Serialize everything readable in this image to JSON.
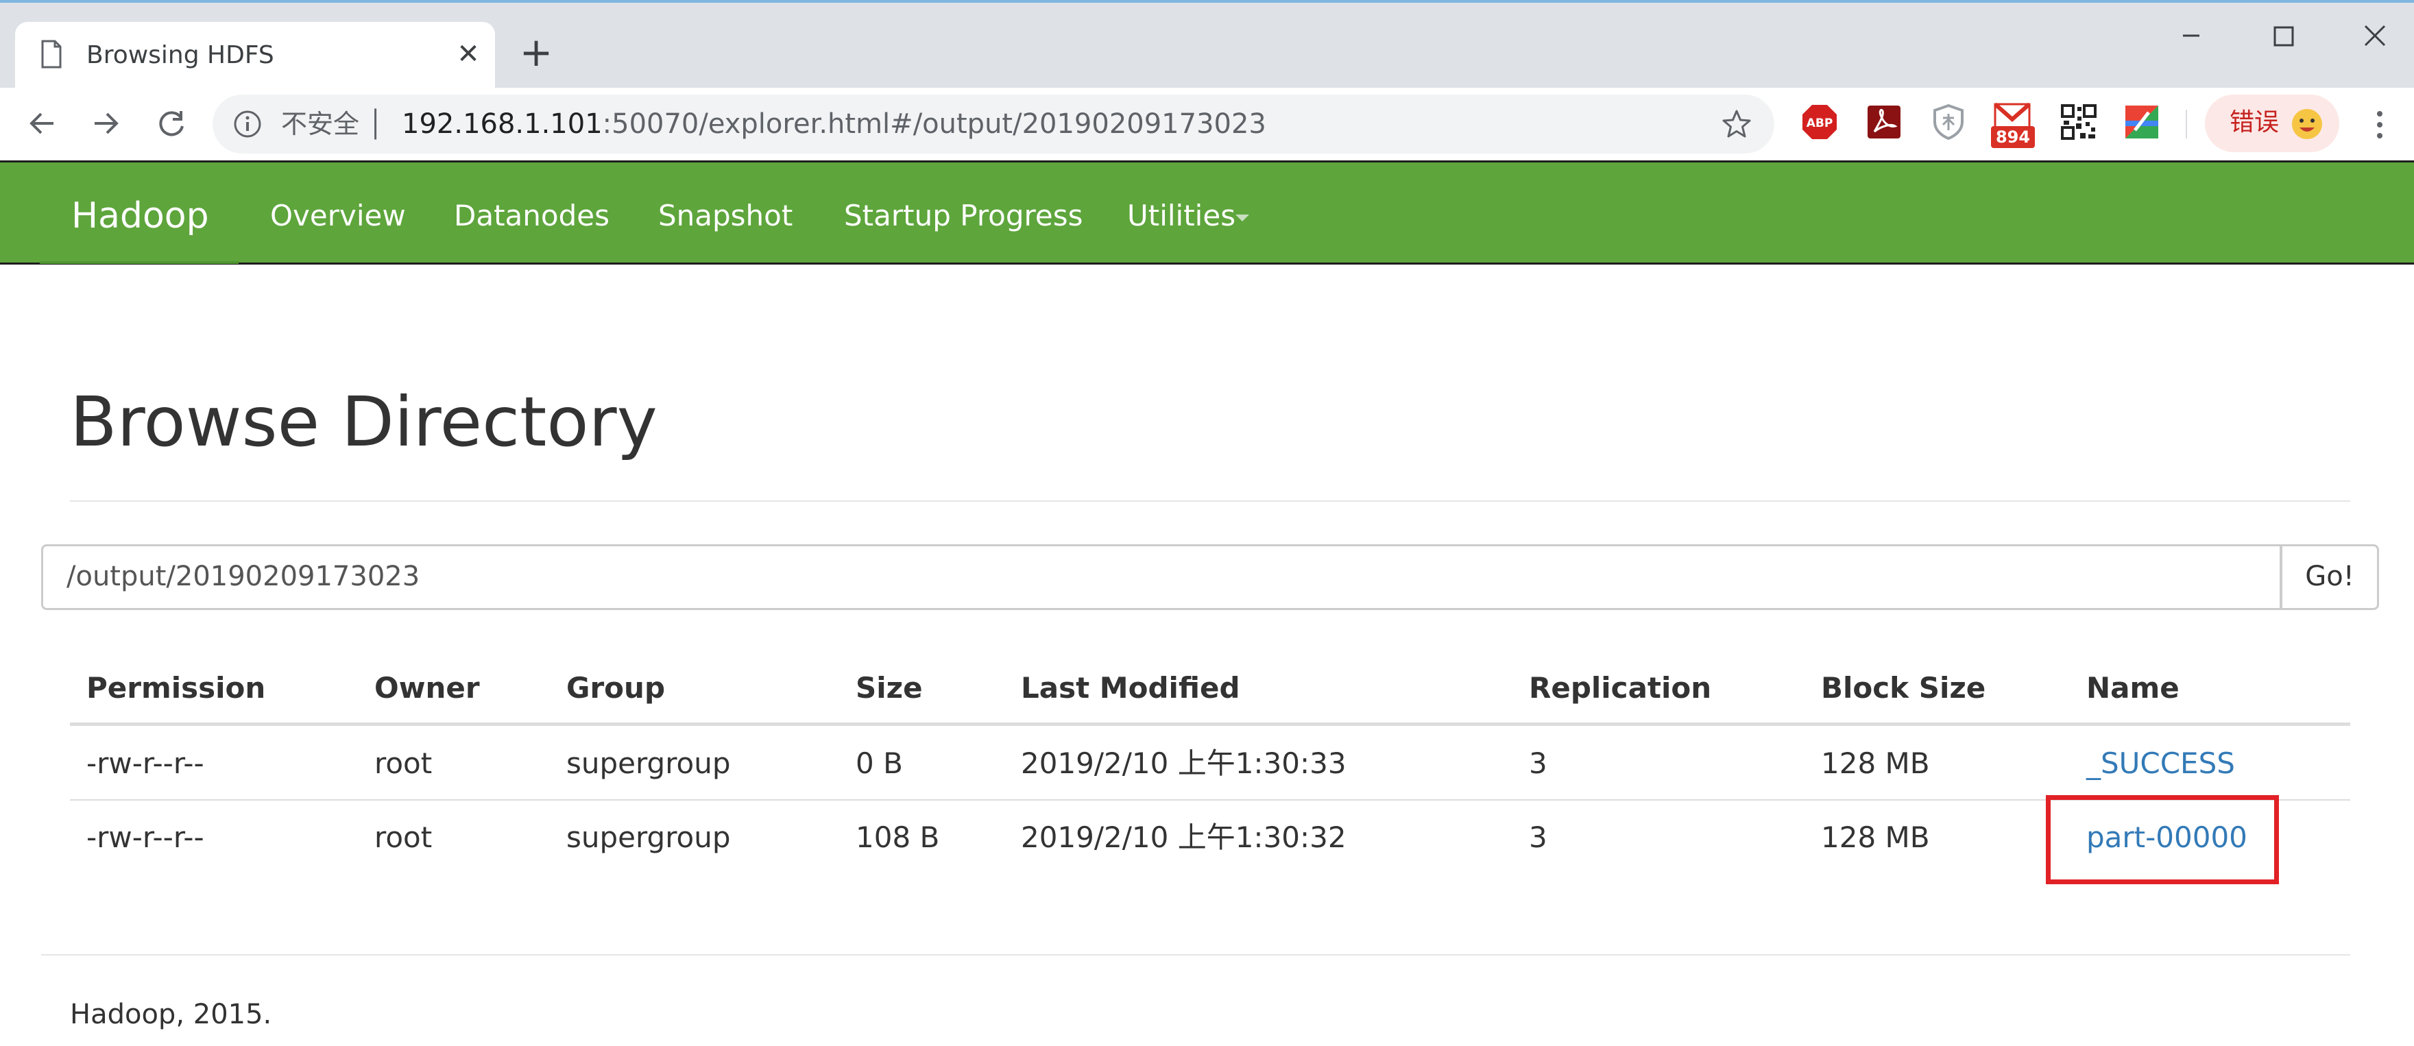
{
  "browser": {
    "tab": {
      "title": "Browsing HDFS",
      "close_glyph": "✕"
    },
    "new_tab_glyph": "+",
    "address_bar": {
      "security_label": "不安全 │",
      "url_host": "192.168.1.101",
      "url_rest": ":50070/explorer.html#/output/20190209173023"
    },
    "extensions": [
      "abp-icon",
      "pdf-icon",
      "shield-extension-icon",
      "gmail-icon",
      "qr-code-icon",
      "colorful-extension-icon"
    ],
    "gmail_badge": "894",
    "abp_label": "ABP",
    "error_pill": {
      "label": "错误"
    }
  },
  "navbar": {
    "brand": "Hadoop",
    "links": [
      "Overview",
      "Datanodes",
      "Snapshot",
      "Startup Progress",
      "Utilities"
    ]
  },
  "page": {
    "title": "Browse Directory",
    "directory_input": "/output/20190209173023",
    "go_button": "Go!"
  },
  "table": {
    "columns": [
      "Permission",
      "Owner",
      "Group",
      "Size",
      "Last Modified",
      "Replication",
      "Block Size",
      "Name"
    ],
    "rows": [
      [
        "-rw-r--r--",
        "root",
        "supergroup",
        "0 B",
        "2019/2/10 上午1:30:33",
        "3",
        "128 MB",
        "_SUCCESS"
      ],
      [
        "-rw-r--r--",
        "root",
        "supergroup",
        "108 B",
        "2019/2/10 上午1:30:32",
        "3",
        "128 MB",
        "part-00000"
      ]
    ]
  },
  "footer": "Hadoop, 2015.",
  "colors": {
    "navbar_green": "#5ea53c",
    "link_blue": "#337ab7",
    "highlight_red": "#e12126",
    "error_red": "#c5221f"
  }
}
